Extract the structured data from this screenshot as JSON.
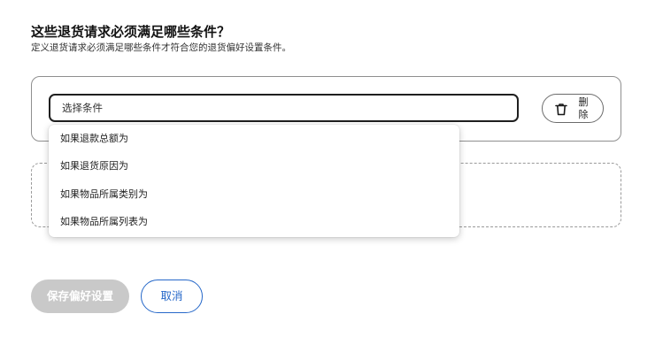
{
  "header": {
    "title": "这些退货请求必须满足哪些条件？",
    "subtitle": "定义退货请求必须满足哪些条件才符合您的退货偏好设置条件。"
  },
  "condition": {
    "select_placeholder": "选择条件",
    "delete_label": "删除",
    "delete_icon": "trash-icon"
  },
  "dropdown": {
    "options": [
      "如果退款总额为",
      "如果退货原因为",
      "如果物品所属类别为",
      "如果物品所属列表为"
    ]
  },
  "footer": {
    "save_label": "保存偏好设置",
    "cancel_label": "取消"
  },
  "colors": {
    "accent": "#2668c9",
    "disabled_button": "#c9c9c9"
  }
}
